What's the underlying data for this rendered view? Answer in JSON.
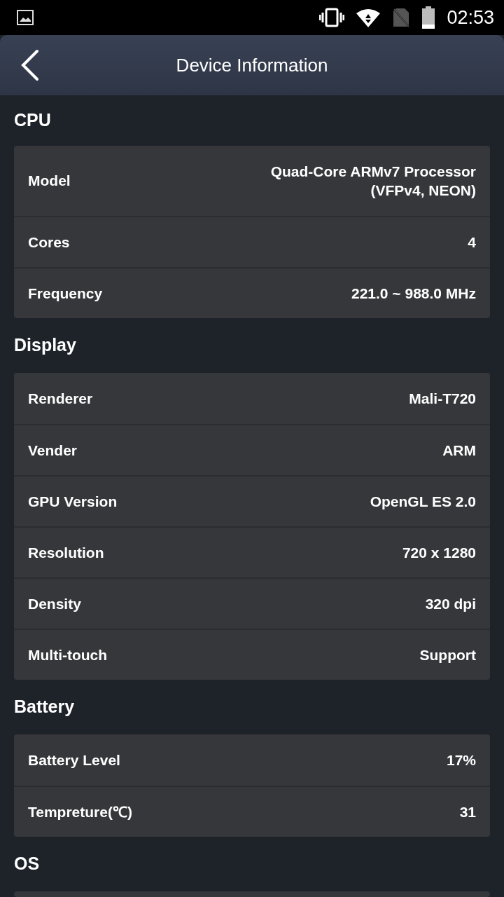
{
  "status_bar": {
    "time": "02:53"
  },
  "header": {
    "title": "Device Information"
  },
  "sections": [
    {
      "title": "CPU",
      "rows": [
        {
          "label": "Model",
          "value": "Quad-Core ARMv7 Processor (VFPv4, NEON)"
        },
        {
          "label": "Cores",
          "value": "4"
        },
        {
          "label": "Frequency",
          "value": "221.0 ~ 988.0 MHz"
        }
      ]
    },
    {
      "title": "Display",
      "rows": [
        {
          "label": "Renderer",
          "value": "Mali-T720"
        },
        {
          "label": "Vender",
          "value": "ARM"
        },
        {
          "label": "GPU Version",
          "value": "OpenGL ES 2.0"
        },
        {
          "label": "Resolution",
          "value": "720 x 1280"
        },
        {
          "label": "Density",
          "value": "320 dpi"
        },
        {
          "label": "Multi-touch",
          "value": "Support"
        }
      ]
    },
    {
      "title": "Battery",
      "rows": [
        {
          "label": "Battery Level",
          "value": "17%"
        },
        {
          "label": "Tempreture(℃)",
          "value": "31"
        }
      ]
    },
    {
      "title": "OS"
    }
  ]
}
